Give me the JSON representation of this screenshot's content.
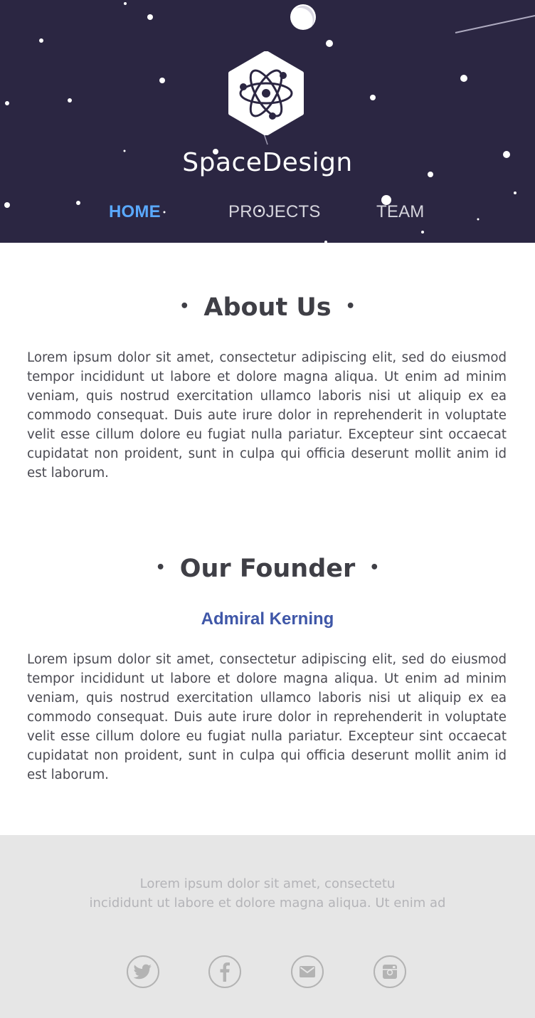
{
  "brand": {
    "name": "SpaceDesign",
    "logo_icon": "atom-hexagon-icon"
  },
  "nav": {
    "items": [
      {
        "label": "HOME",
        "active": true
      },
      {
        "label": "PROJECTS",
        "active": false
      },
      {
        "label": "TEAM",
        "active": false
      }
    ]
  },
  "about": {
    "title": "About Us",
    "text": "Lorem ipsum dolor sit amet, consectetur adipiscing elit, sed do eiusmod tempor incididunt ut labore et dolore magna aliqua. Ut enim ad minim veniam, quis nostrud exercitation ullamco laboris nisi ut aliquip ex ea commodo consequat. Duis aute irure dolor in reprehenderit in voluptate velit esse cillum dolore eu fugiat nulla pariatur. Excepteur sint occaecat cupidatat non proident, sunt in culpa qui officia deserunt mollit anim id est laborum."
  },
  "founder": {
    "title": "Our Founder",
    "name": "Admiral Kerning",
    "text": "Lorem ipsum dolor sit amet, consectetur adipiscing elit, sed do eiusmod tempor incididunt ut labore et dolore magna aliqua. Ut enim ad minim veniam, quis nostrud exercitation ullamco laboris nisi ut aliquip ex ea commodo consequat. Duis aute irure dolor in reprehenderit in voluptate velit esse cillum dolore eu fugiat nulla pariatur. Excepteur sint occaecat cupidatat non proident, sunt in culpa qui officia deserunt mollit anim id est laborum."
  },
  "footer": {
    "line1": "Lorem ipsum dolor sit amet, consectetu",
    "line2": "incididunt ut labore et dolore magna aliqua. Ut enim ad",
    "social": [
      "twitter-icon",
      "facebook-icon",
      "mail-icon",
      "instagram-icon"
    ]
  },
  "colors": {
    "header_bg": "#2b2642",
    "nav_active": "#5aa9ff",
    "founder_name": "#3f57a8",
    "footer_bg": "#e6e6e6"
  }
}
